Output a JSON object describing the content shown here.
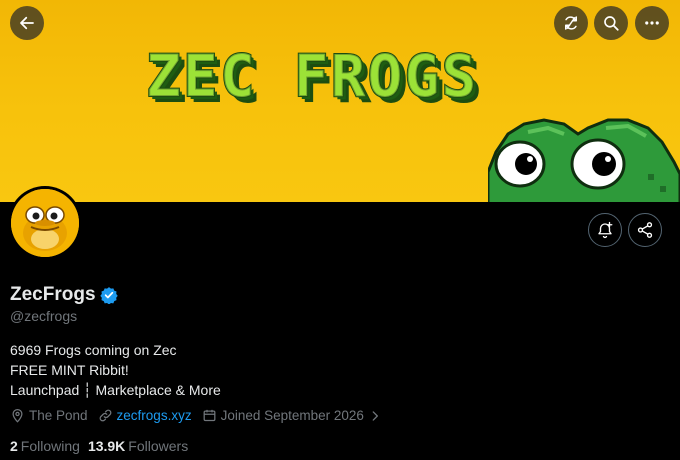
{
  "banner": {
    "title_art": "ZEC FROGS",
    "mascot": "pixel-frog-icon"
  },
  "header_buttons": {
    "back_icon": "arrow-left-icon",
    "refresh_icon": "refresh-icon",
    "search_icon": "search-icon",
    "more_icon": "more-horizontal-icon"
  },
  "profile": {
    "display_name": "ZecFrogs",
    "verified": true,
    "handle": "@zecfrogs",
    "bio": [
      "6969 Frogs coming on Zec",
      "FREE MINT Ribbit!",
      "Launchpad ┆ Marketplace & More"
    ],
    "location": "The Pond",
    "website": "zecfrogs.xyz",
    "joined": "Joined September 2026",
    "following_count": "2",
    "following_label": "Following",
    "followers_count": "13.9K",
    "followers_label": "Followers"
  },
  "actions": {
    "notify_icon": "bell-plus-icon",
    "share_icon": "share-icon"
  },
  "colors": {
    "banner_yellow": "#f7c20c",
    "frog_green": "#2e9a3a",
    "link_blue": "#1d9bf0",
    "verified_blue": "#1d9bf0",
    "muted": "#71767b"
  }
}
